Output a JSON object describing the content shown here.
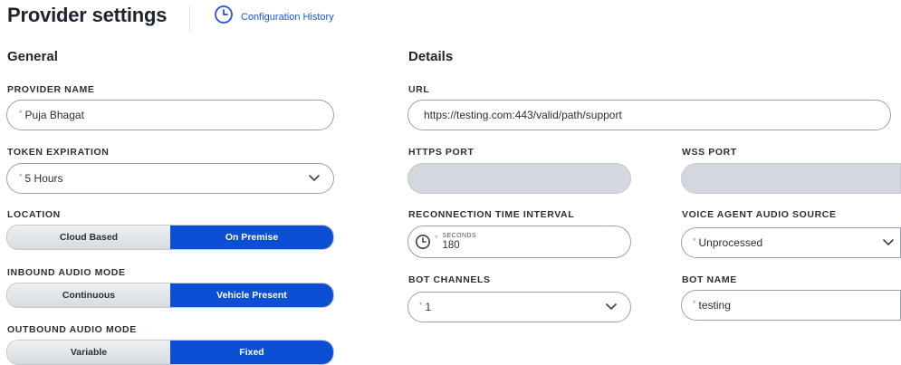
{
  "header": {
    "title": "Provider settings",
    "history_label": "Configuration History"
  },
  "general": {
    "title": "General",
    "provider_name": {
      "label": "PROVIDER NAME",
      "value": "Puja Bhagat"
    },
    "token_expiration": {
      "label": "TOKEN EXPIRATION",
      "value": "5 Hours"
    },
    "location": {
      "label": "LOCATION",
      "options": [
        "Cloud Based",
        "On Premise"
      ],
      "selected": "On Premise"
    },
    "inbound_audio_mode": {
      "label": "INBOUND AUDIO MODE",
      "options": [
        "Continuous",
        "Vehicle Present"
      ],
      "selected": "Vehicle Present"
    },
    "outbound_audio_mode": {
      "label": "OUTBOUND AUDIO MODE",
      "options": [
        "Variable",
        "Fixed"
      ],
      "selected": "Fixed"
    }
  },
  "details": {
    "title": "Details",
    "url": {
      "label": "URL",
      "value": "https://testing.com:443/valid/path/support"
    },
    "https_port": {
      "label": "HTTPS PORT",
      "value": ""
    },
    "wss_port": {
      "label": "WSS PORT",
      "value": ""
    },
    "reconnection_interval": {
      "label": "RECONNECTION TIME INTERVAL",
      "unit": "SECONDS",
      "value": "180"
    },
    "voice_agent_audio_source": {
      "label": "VOICE AGENT AUDIO SOURCE",
      "value": "Unprocessed"
    },
    "bot_channels": {
      "label": "BOT CHANNELS",
      "value": "1"
    },
    "bot_name": {
      "label": "BOT NAME",
      "value": "testing"
    }
  },
  "colors": {
    "accent": "#0c4fd4",
    "link": "#1f56d8",
    "disabled_field": "#d4d8de"
  },
  "icons": {
    "history": "clock-icon",
    "dropdown": "chevron-down-icon",
    "time": "clock-icon"
  }
}
